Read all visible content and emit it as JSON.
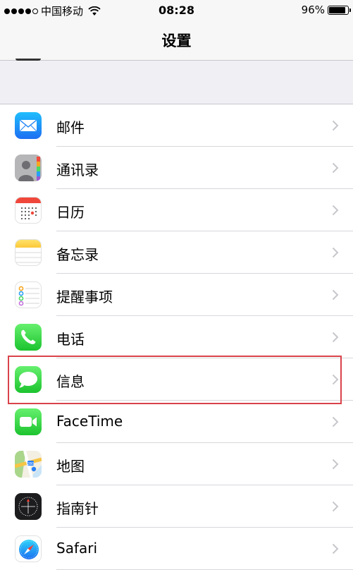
{
  "status_bar": {
    "signal_bars": 4,
    "signal_bars_total": 5,
    "carrier": "中国移动",
    "time": "08:28",
    "battery": "96%",
    "battery_level": 0.96
  },
  "nav": {
    "title": "设置"
  },
  "settings": [
    {
      "label": "邮件",
      "icon": "mail-icon"
    },
    {
      "label": "通讯录",
      "icon": "contacts-icon"
    },
    {
      "label": "日历",
      "icon": "calendar-icon"
    },
    {
      "label": "备忘录",
      "icon": "notes-icon"
    },
    {
      "label": "提醒事项",
      "icon": "reminders-icon"
    },
    {
      "label": "电话",
      "icon": "phone-icon"
    },
    {
      "label": "信息",
      "icon": "messages-icon",
      "highlighted": true
    },
    {
      "label": "FaceTime",
      "icon": "facetime-icon"
    },
    {
      "label": "地图",
      "icon": "maps-icon"
    },
    {
      "label": "指南针",
      "icon": "compass-icon"
    },
    {
      "label": "Safari",
      "icon": "safari-icon"
    }
  ],
  "colors": {
    "background": "#efeff4",
    "highlight": "#d9434a",
    "chevron": "#c7c7cc"
  }
}
